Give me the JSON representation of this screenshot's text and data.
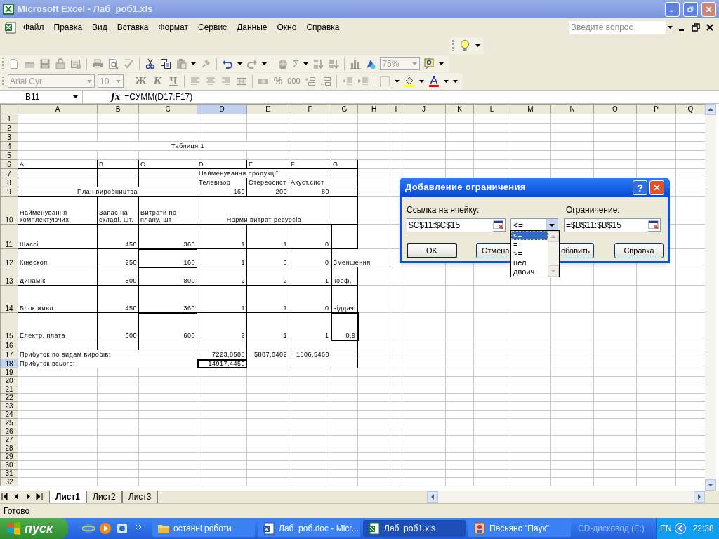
{
  "window": {
    "title": "Microsoft Excel - Лаб_роб1.xls"
  },
  "menu": [
    "Файл",
    "Правка",
    "Вид",
    "Вставка",
    "Формат",
    "Сервис",
    "Данные",
    "Окно",
    "Справка"
  ],
  "help_search": {
    "placeholder": "Введите вопрос"
  },
  "toolbar": {
    "sum": "Σ",
    "zoom": "75%",
    "font": "Arial Cyr",
    "size": "10",
    "bold": "Ж",
    "italic": "К",
    "underline": "Ч",
    "percent": "%",
    "thousands": "000"
  },
  "formula_bar": {
    "name_box": "B11",
    "fx": "fx",
    "formula": "=СУММ(D17:F17)"
  },
  "sheet": {
    "columns": [
      {
        "label": "A",
        "selected": false
      },
      {
        "label": "B",
        "selected": false
      },
      {
        "label": "C",
        "selected": false
      },
      {
        "label": "D",
        "selected": true
      },
      {
        "label": "E",
        "selected": false
      },
      {
        "label": "F",
        "selected": false
      },
      {
        "label": "G",
        "selected": false
      },
      {
        "label": "H",
        "selected": false
      },
      {
        "label": "I",
        "selected": false
      },
      {
        "label": "J",
        "selected": false
      },
      {
        "label": "K",
        "selected": false
      },
      {
        "label": "L",
        "selected": false
      },
      {
        "label": "M",
        "selected": false
      },
      {
        "label": "N",
        "selected": false
      },
      {
        "label": "O",
        "selected": false
      },
      {
        "label": "P",
        "selected": false
      },
      {
        "label": "Q",
        "selected": false
      }
    ],
    "rows": [
      {
        "header": "1",
        "selected": false
      },
      {
        "header": "2",
        "selected": false
      },
      {
        "header": "3",
        "selected": false
      },
      {
        "header": "4",
        "selected": false,
        "cells": {
          "A": "Таблиця 1"
        }
      },
      {
        "header": "5",
        "selected": false
      },
      {
        "header": "6",
        "selected": false,
        "cells": {
          "A": "A",
          "B": "B",
          "C": "C",
          "D": "D",
          "E": "E",
          "F": "F",
          "G": "G"
        }
      },
      {
        "header": "7",
        "selected": false,
        "cells": {
          "D": "Найменування продукції"
        }
      },
      {
        "header": "8",
        "selected": false,
        "cells": {
          "D": "Телевізор",
          "E": "Стереосист",
          "F": "Акуст.сист"
        }
      },
      {
        "header": "9",
        "selected": false,
        "cells": {
          "A": "План виробництва",
          "D": "160",
          "E": "200",
          "F": "80"
        }
      },
      {
        "header": "10",
        "selected": false,
        "cells": {
          "A": "Найменування комплектуючих",
          "B": "Запас на складі, шт.",
          "C": "Витрати по плану, шт",
          "D": "Норми витрат ресурсів"
        }
      },
      {
        "header": "11",
        "selected": false,
        "cells": {
          "A": "Шассі",
          "B": "450",
          "C": "360",
          "D": "1",
          "E": "1",
          "F": "0"
        }
      },
      {
        "header": "12",
        "selected": false,
        "cells": {
          "A": "Кінескоп",
          "B": "250",
          "C": "160",
          "D": "1",
          "E": "0",
          "F": "0",
          "G": "Зменшення"
        }
      },
      {
        "header": "13",
        "selected": false,
        "cells": {
          "A": "Динамік",
          "B": "800",
          "C": "800",
          "D": "2",
          "E": "2",
          "F": "1",
          "G": "коеф."
        }
      },
      {
        "header": "14",
        "selected": false,
        "cells": {
          "A": "Блок живл.",
          "B": "450",
          "C": "360",
          "D": "1",
          "E": "1",
          "F": "0",
          "G": "віддачі"
        }
      },
      {
        "header": "15",
        "selected": false,
        "cells": {
          "A": "Електр. плата",
          "B": "600",
          "C": "600",
          "D": "2",
          "E": "1",
          "F": "1",
          "G": "0,9"
        }
      },
      {
        "header": "16",
        "selected": false
      },
      {
        "header": "17",
        "selected": false,
        "cells": {
          "A": "Прибуток по видам виробів:",
          "D": "7223,8588",
          "E": "5887,0402",
          "F": "1806,5460"
        }
      },
      {
        "header": "18",
        "selected": true,
        "cells": {
          "A": "Прибуток всього:",
          "D": "14917,4450"
        }
      },
      {
        "header": "19",
        "selected": false
      },
      {
        "header": "20",
        "selected": false
      },
      {
        "header": "21",
        "selected": false
      },
      {
        "header": "22",
        "selected": false
      },
      {
        "header": "23",
        "selected": false
      },
      {
        "header": "24",
        "selected": false
      },
      {
        "header": "25",
        "selected": false
      },
      {
        "header": "26",
        "selected": false
      },
      {
        "header": "27",
        "selected": false
      },
      {
        "header": "28",
        "selected": false
      },
      {
        "header": "29",
        "selected": false
      },
      {
        "header": "30",
        "selected": false
      },
      {
        "header": "31",
        "selected": false
      },
      {
        "header": "32",
        "selected": false
      }
    ]
  },
  "sheet_tabs": [
    {
      "label": "Лист1",
      "selected": true
    },
    {
      "label": "Лист2",
      "selected": false
    },
    {
      "label": "Лист3",
      "selected": false
    }
  ],
  "status_bar": "Готово",
  "dialog": {
    "title": "Добавление ограничения",
    "help": "?",
    "cell_label": "Ссылка на ячейку:",
    "cell_value": "$C$11:$C$15",
    "operator": "<=",
    "constraint_label": "Ограничение:",
    "constraint_value": "=$B$11:$B$15",
    "options": [
      {
        "label": "<=",
        "selected": true
      },
      {
        "label": "=",
        "selected": false
      },
      {
        "label": ">=",
        "selected": false
      },
      {
        "label": "цел",
        "selected": false
      },
      {
        "label": "двоич",
        "selected": false
      }
    ],
    "buttons": [
      {
        "label": "OK",
        "default": true
      },
      {
        "label": "Отмена",
        "default": false
      },
      {
        "label": "обавить",
        "default": false
      },
      {
        "label": "Справка",
        "default": false
      }
    ]
  },
  "taskbar": {
    "start": "пуск",
    "tasks": [
      {
        "label": "останні роботи",
        "kind": "folder",
        "selected": false
      },
      {
        "label": "Лаб_роб.doc - Micr...",
        "kind": "word",
        "selected": false
      },
      {
        "label": "Лаб_роб1.xls",
        "kind": "excel",
        "selected": true
      },
      {
        "label": "Пасьянс \"Паук\"",
        "kind": "game",
        "selected": false
      }
    ],
    "drive": "CD-дисковод (F:)",
    "language": "EN",
    "clock": "22:38"
  }
}
